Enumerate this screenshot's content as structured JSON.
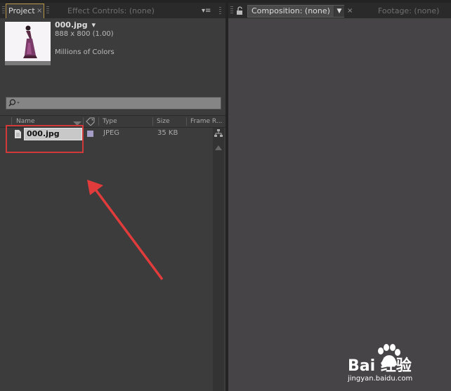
{
  "project_tabs": {
    "project_label": "Project",
    "project_close": "×",
    "effect_controls_label": "Effect Controls: (none)",
    "menu_glyph": "▾≡"
  },
  "comp_tabs": {
    "composition_label": "Composition: (none)",
    "dropdown_glyph": "▼",
    "close_glyph": "×",
    "footage_label": "Footage: (none)"
  },
  "preview": {
    "filename": "000.jpg",
    "dropdown": "▾",
    "dimensions": "888 x 800 (1.00)",
    "color_depth": "Millions of Colors"
  },
  "search": {
    "icon": "search-icon",
    "placeholder": ""
  },
  "columns": {
    "name": "Name",
    "type": "Type",
    "size": "Size",
    "frame_rate": "Frame R..."
  },
  "rows": [
    {
      "name": "000.jpg",
      "type": "JPEG",
      "size": "35 KB",
      "label_color": "#a79ec8"
    }
  ],
  "colors": {
    "highlight_box": "#d23a3a",
    "arrow": "#e23b3b",
    "active_tab_border": "#b89848"
  },
  "watermark": {
    "brand": "Bai 经验",
    "url": "jingyan.baidu.com"
  }
}
